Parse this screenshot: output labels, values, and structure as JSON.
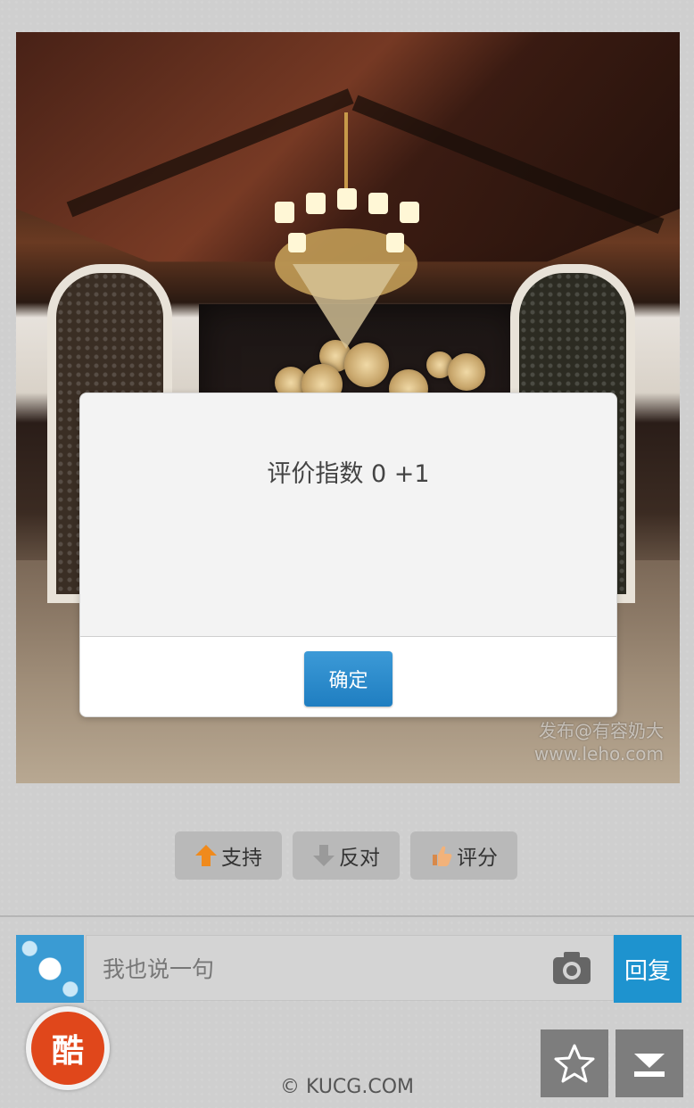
{
  "photo": {
    "watermark_line1": "发布@有容奶大",
    "watermark_line2": "www.leho.com"
  },
  "dialog": {
    "message": "评价指数 0 +1",
    "confirm_label": "确定"
  },
  "actions": {
    "support_label": "支持",
    "oppose_label": "反对",
    "rate_label": "评分"
  },
  "reply": {
    "placeholder": "我也说一句",
    "send_label": "回复"
  },
  "footer": {
    "logo_text": "酷",
    "copyright": "© KUCG.COM"
  },
  "icons": {
    "support": "up-arrow-icon",
    "oppose": "down-arrow-icon",
    "rate": "thumbs-up-icon",
    "camera": "camera-icon",
    "favorite": "star-icon",
    "download": "download-icon"
  },
  "colors": {
    "confirm_button": "#2288cc",
    "reply_button": "#1e93cf",
    "logo_red": "#e0471b",
    "action_button": "#b9b9b9"
  }
}
